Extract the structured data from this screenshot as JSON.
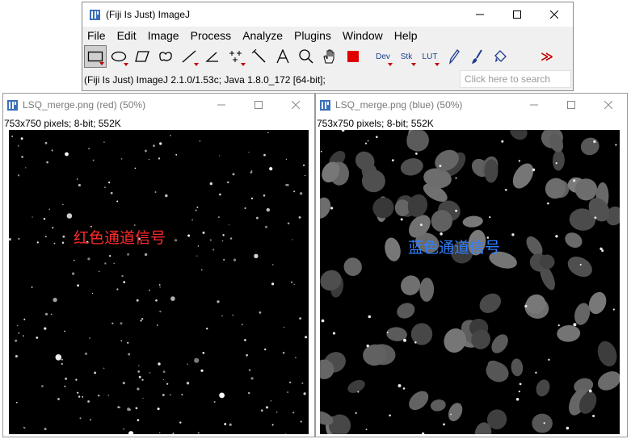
{
  "main_window": {
    "title": "(Fiji Is Just) ImageJ",
    "menus": [
      "File",
      "Edit",
      "Image",
      "Process",
      "Analyze",
      "Plugins",
      "Window",
      "Help"
    ],
    "toolbar": {
      "tools": [
        "rectangle-selection",
        "oval-selection",
        "polygon-selection",
        "freehand-selection",
        "line-selection",
        "angle-tool",
        "point-tool",
        "wand-tool",
        "text-tool",
        "magnifying-glass",
        "scrolling-tool",
        "color-picker"
      ],
      "dev_label": "Dev",
      "stk_label": "Stk",
      "lut_label": "LUT",
      "extra_tools": [
        "pencil-tool",
        "paintbrush-tool",
        "flood-fill-tool"
      ],
      "more_label": "≫",
      "foreground_color": "#e00000"
    },
    "status": "(Fiji Is Just) ImageJ 2.1.0/1.53c; Java 1.8.0_172 [64-bit];",
    "search_placeholder": "Click here to search"
  },
  "red_window": {
    "title": "LSQ_merge.png (red) (50%)",
    "info": "753x750 pixels; 8-bit; 552K",
    "overlay_text": "红色通道信号",
    "overlay_color": "#ff2a2a"
  },
  "blue_window": {
    "title": "LSQ_merge.png (blue) (50%)",
    "info": "753x750 pixels; 8-bit; 552K",
    "overlay_text": "蓝色通道信号",
    "overlay_color": "#2f7fff"
  }
}
